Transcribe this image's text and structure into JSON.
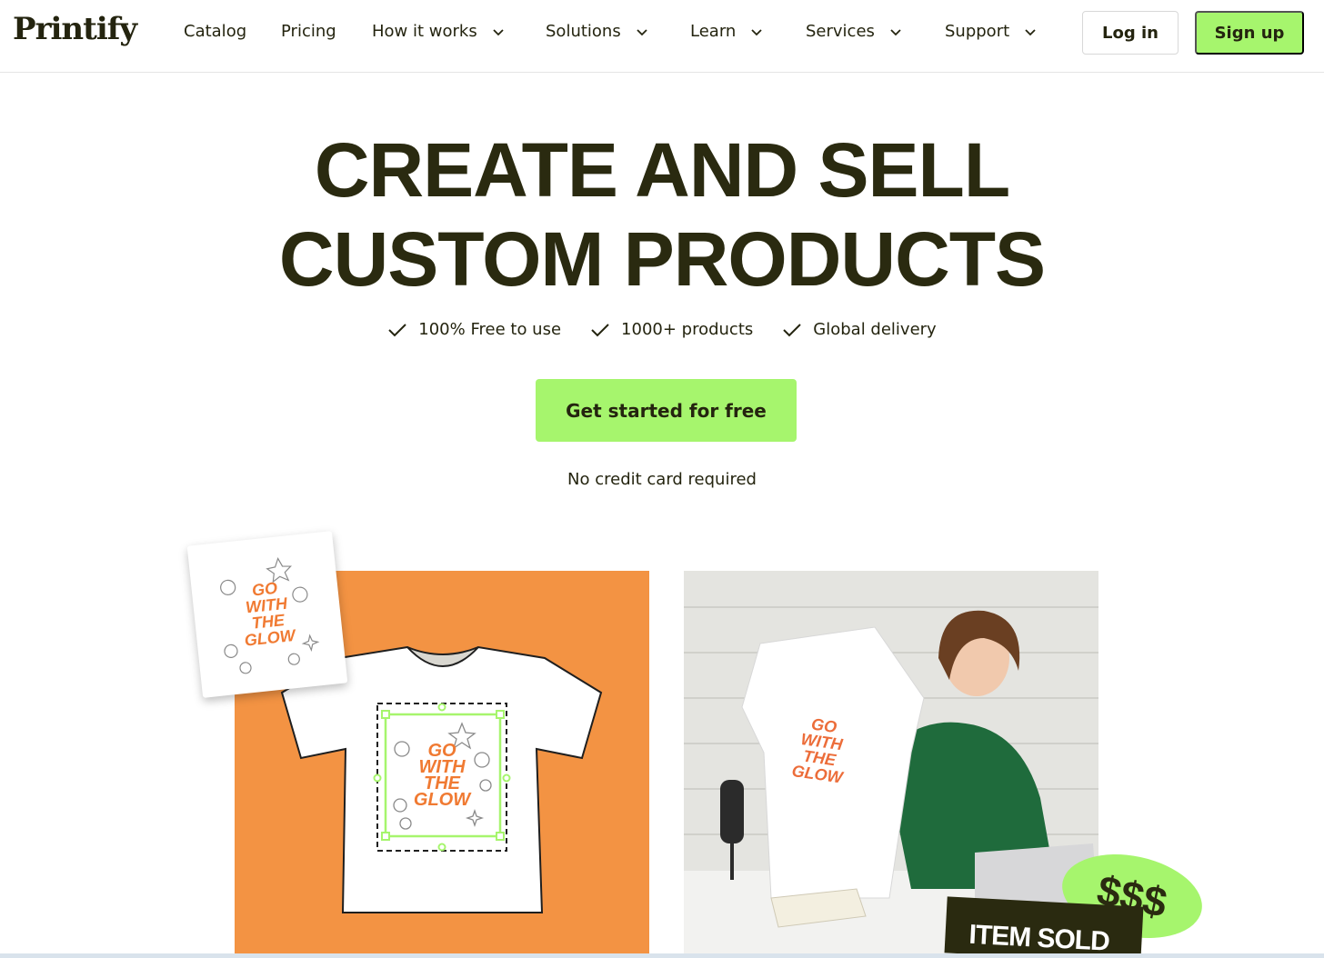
{
  "header": {
    "logo": "Printify",
    "nav": [
      {
        "label": "Catalog",
        "has_dropdown": false
      },
      {
        "label": "Pricing",
        "has_dropdown": false
      },
      {
        "label": "How it works",
        "has_dropdown": true
      },
      {
        "label": "Solutions",
        "has_dropdown": true
      },
      {
        "label": "Learn",
        "has_dropdown": true
      },
      {
        "label": "Services",
        "has_dropdown": true
      },
      {
        "label": "Support",
        "has_dropdown": true
      }
    ],
    "login_label": "Log in",
    "signup_label": "Sign up"
  },
  "hero": {
    "title_line1": "CREATE AND SELL",
    "title_line2": "CUSTOM PRODUCTS",
    "features": [
      "100% Free to use",
      "1000+ products",
      "Global delivery"
    ],
    "cta_label": "Get started for free",
    "subnote": "No credit card required"
  },
  "artwork": {
    "design_text": [
      "GO",
      "WITH",
      "THE",
      "GLOW"
    ],
    "badge_text": "$$$",
    "sold_text": "ITEM SOLD"
  },
  "colors": {
    "accent_green": "#a6f56d",
    "dark_text": "#24240f",
    "orange_panel": "#f39343",
    "design_orange": "#f07a32"
  }
}
